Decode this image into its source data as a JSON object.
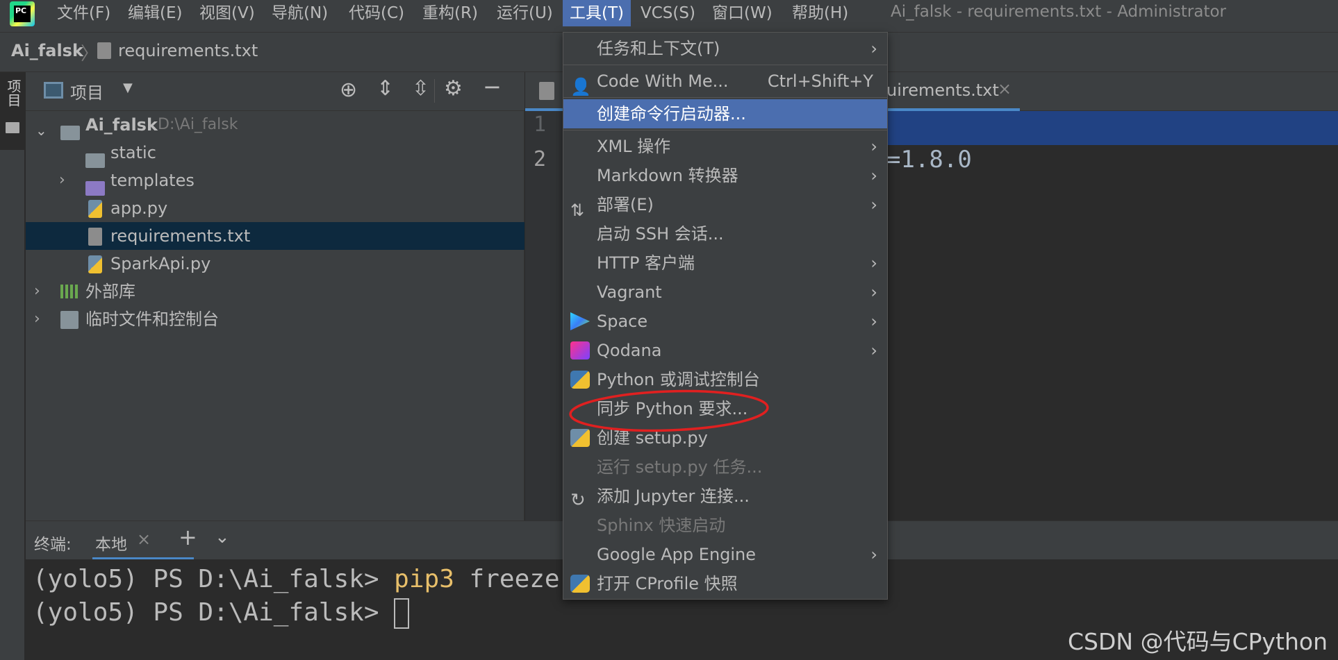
{
  "menubar": {
    "items": [
      "文件(F)",
      "编辑(E)",
      "视图(V)",
      "导航(N)",
      "代码(C)",
      "重构(R)",
      "运行(U)",
      "工具(T)",
      "VCS(S)",
      "窗口(W)",
      "帮助(H)"
    ],
    "window_title": "Ai_falsk - requirements.txt - Administrator",
    "app_icon_text": "PC"
  },
  "breadcrumb": {
    "project": "Ai_falsk",
    "file": "requirements.txt"
  },
  "left_strip": {
    "project_label": "项目"
  },
  "project_panel": {
    "title": "项目",
    "tree": [
      {
        "label": "Ai_falsk",
        "path": "D:\\Ai_falsk"
      },
      {
        "label": "static"
      },
      {
        "label": "templates"
      },
      {
        "label": "app.py"
      },
      {
        "label": "requirements.txt"
      },
      {
        "label": "SparkApi.py"
      },
      {
        "label": "外部库"
      },
      {
        "label": "临时文件和控制台"
      }
    ]
  },
  "editor": {
    "tab_label_visible": "uirements.txt",
    "line_numbers": [
      "1",
      "2"
    ],
    "line2_visible": "=1.8.0"
  },
  "terminal": {
    "label": "终端:",
    "tab": "本地",
    "line1_prefix": "(yolo5) PS D:\\Ai_falsk> ",
    "line1_cmd": "pip3",
    "line1_rest": " freeze",
    "line2_prefix": "(yolo5) PS D:\\Ai_falsk> "
  },
  "dropdown": {
    "items": [
      {
        "label": "任务和上下文(T)",
        "submenu": true
      },
      {
        "label": "Code With Me...",
        "shortcut": "Ctrl+Shift+Y"
      },
      {
        "label": "创建命令行启动器...",
        "highlighted": true
      },
      {
        "label": "XML 操作",
        "submenu": true
      },
      {
        "label": "Markdown 转换器",
        "submenu": true
      },
      {
        "label": "部署(E)",
        "submenu": true
      },
      {
        "label": "启动 SSH 会话..."
      },
      {
        "label": "HTTP 客户端",
        "submenu": true
      },
      {
        "label": "Vagrant",
        "submenu": true
      },
      {
        "label": "Space",
        "submenu": true
      },
      {
        "label": "Qodana",
        "submenu": true
      },
      {
        "label": "Python 或调试控制台"
      },
      {
        "label": "同步 Python 要求..."
      },
      {
        "label": "创建 setup.py"
      },
      {
        "label": "运行 setup.py 任务...",
        "disabled": true
      },
      {
        "label": "添加 Jupyter 连接..."
      },
      {
        "label": "Sphinx 快速启动",
        "disabled": true
      },
      {
        "label": "Google App Engine",
        "submenu": true
      },
      {
        "label": "打开 CProfile 快照"
      }
    ]
  },
  "watermark": "CSDN @代码与CPython",
  "colors": {
    "menu_highlight": "#4b6eaf",
    "selection_row": "#0d293e",
    "annotation_circle": "#e02020",
    "command_yellow": "#e8bf6a"
  }
}
